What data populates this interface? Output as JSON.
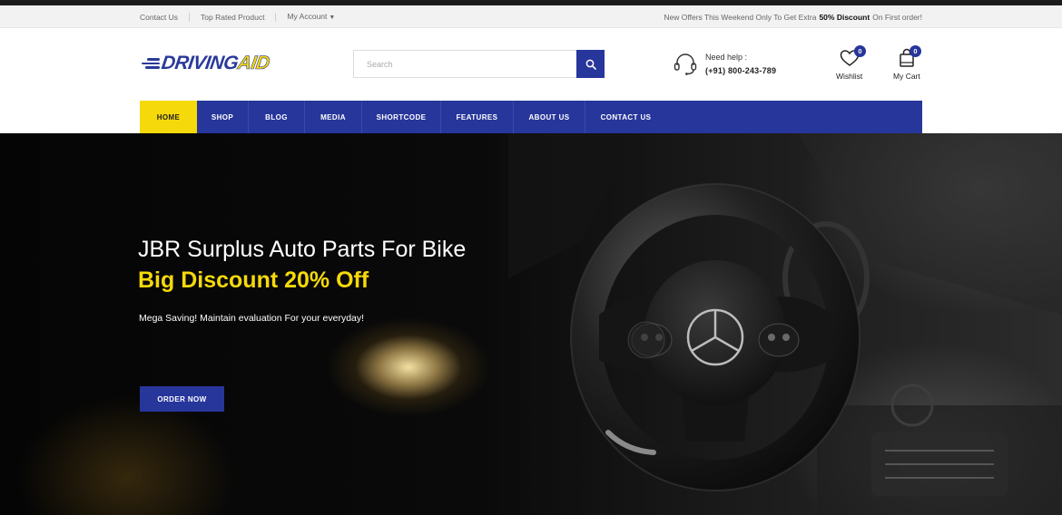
{
  "topbar": {
    "links": [
      {
        "label": "Contact Us"
      },
      {
        "label": "Top Rated Product"
      },
      {
        "label": "My Account"
      }
    ],
    "promo": {
      "before": "New Offers This Weekend Only To Get Extra",
      "highlight": "50% Discount",
      "after": "On First order!"
    }
  },
  "header": {
    "logo": {
      "part1": "DRIVING",
      "part2": "AID"
    },
    "search": {
      "placeholder": "Search"
    },
    "help": {
      "label": "Need help :",
      "phone": "(+91) 800-243-789"
    },
    "wishlist": {
      "label": "Wishlist",
      "count": "0"
    },
    "cart": {
      "label": "My Cart",
      "count": "0"
    }
  },
  "nav": {
    "items": [
      {
        "label": "HOME"
      },
      {
        "label": "SHOP"
      },
      {
        "label": "BLOG"
      },
      {
        "label": "MEDIA"
      },
      {
        "label": "SHORTCODE"
      },
      {
        "label": "FEATURES"
      },
      {
        "label": "ABOUT US"
      },
      {
        "label": "CONTACT US"
      }
    ]
  },
  "hero": {
    "title": "JBR Surplus Auto Parts For Bike",
    "discount": "Big Discount 20% Off",
    "subtitle": "Mega Saving! Maintain evaluation For your everyday!",
    "button": "ORDER NOW"
  },
  "colors": {
    "brand_blue": "#27369b",
    "accent_yellow": "#f5d90a",
    "topbar_bg": "#f2f2f2"
  },
  "icons": [
    "search-icon",
    "headset-icon",
    "heart-icon",
    "shopping-bag-icon",
    "caret-down-icon",
    "steering-wheel-icon"
  ]
}
